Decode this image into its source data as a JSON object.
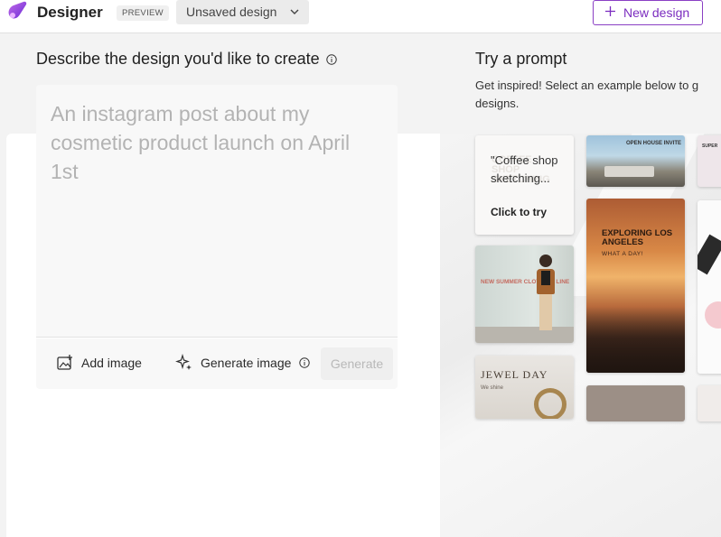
{
  "header": {
    "app_title": "Designer",
    "badge": "PREVIEW",
    "design_name": "Unsaved design",
    "new_design_label": "New design"
  },
  "describe": {
    "title": "Describe the design you'd like to create",
    "placeholder": "An instagram post about my cosmetic product launch on April 1st",
    "add_image_label": "Add image",
    "generate_image_label": "Generate image",
    "generate_button_label": "Generate"
  },
  "try_prompt": {
    "title": "Try a prompt",
    "subtitle": "Get inspired! Select an example below to g designs.",
    "coffee_prompt": "\"Coffee shop sketching...",
    "click_to_try": "Click to try",
    "tiles": {
      "open_house": "OPEN HOUSE INVITE",
      "edge_super": "SUPER",
      "summer_line": "NEW SUMMER CLOTHING LINE",
      "la_title": "EXPLORING LOS ANGELES",
      "la_sub": "WHAT A DAY!",
      "jewel_title": "JEWEL DAY",
      "jewel_sub": "We shine",
      "coffee_ghost": "COFFEE SHOP SKETCHING"
    }
  },
  "colors": {
    "accent": "#7b2cbf",
    "page_bg": "#f3f3f3"
  }
}
